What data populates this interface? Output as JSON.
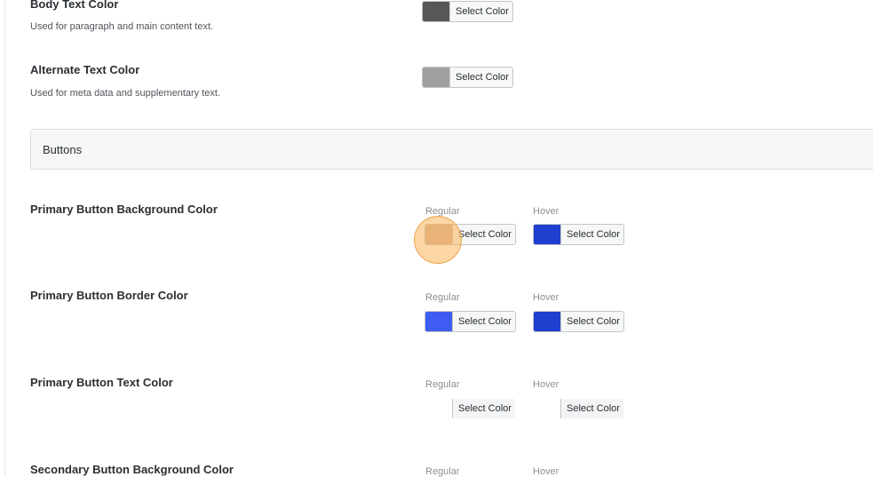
{
  "settings": {
    "body_text": {
      "title": "Body Text Color",
      "desc": "Used for paragraph and main content text.",
      "picker_label": "Select Color",
      "color": "#575757"
    },
    "alt_text": {
      "title": "Alternate Text Color",
      "desc": "Used for meta data and supplementary text.",
      "picker_label": "Select Color",
      "color": "#9fa0a2"
    }
  },
  "section": {
    "label": "Buttons"
  },
  "states": {
    "regular": "Regular",
    "hover": "Hover"
  },
  "buttons": {
    "primary_bg": {
      "title": "Primary Button Background Color",
      "regular_label": "Select Color",
      "regular_color": "#d6b19c",
      "hover_label": "Select Color",
      "hover_color": "#1f3fcf"
    },
    "primary_border": {
      "title": "Primary Button Border Color",
      "regular_label": "Select Color",
      "regular_color": "#3e5cf2",
      "hover_label": "Select Color",
      "hover_color": "#1f3fcf"
    },
    "primary_text": {
      "title": "Primary Button Text Color",
      "regular_label": "Select Color",
      "hover_label": "Select Color"
    },
    "secondary_bg": {
      "title": "Secondary Button Background Color"
    }
  },
  "colors": {
    "cursor_highlight": "#f8b45a"
  }
}
